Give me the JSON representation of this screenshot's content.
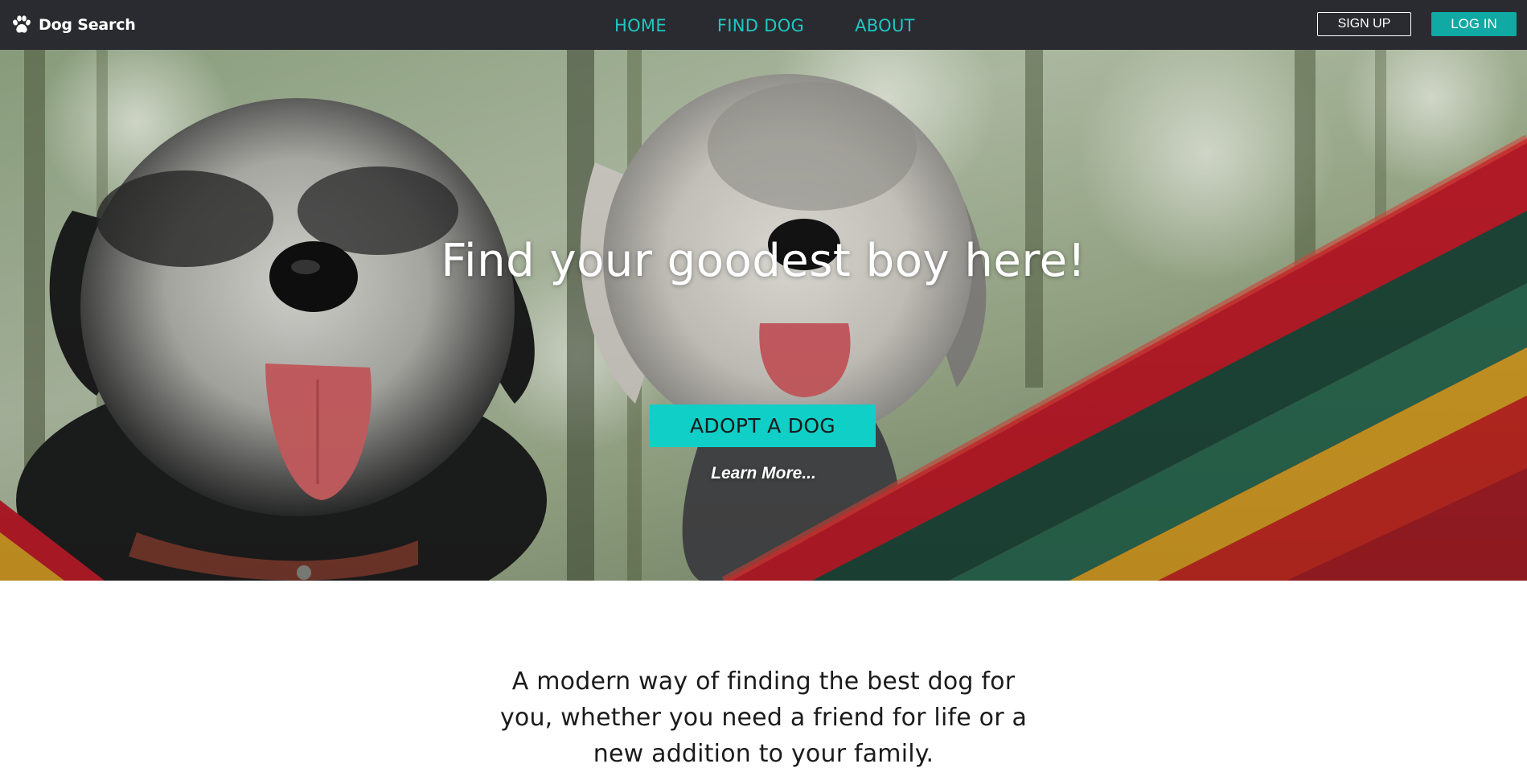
{
  "header": {
    "brand_name": "Dog Search",
    "brand_icon": "paw-icon",
    "nav": [
      "HOME",
      "FIND DOG",
      "ABOUT"
    ],
    "signup_label": "SIGN UP",
    "login_label": "LOG IN"
  },
  "hero": {
    "title": "Find your goodest boy here!",
    "cta_label": "ADOPT A DOG",
    "learn_more": "Learn More..."
  },
  "intro": {
    "text": "A modern way of finding the best dog for you, whether you need a friend for life or a new addition to your family."
  },
  "colors": {
    "navbar_bg": "#2a2b30",
    "accent": "#1ec8c3",
    "login_bg": "#10a9a3",
    "cta_bg": "#0fcfc7"
  }
}
